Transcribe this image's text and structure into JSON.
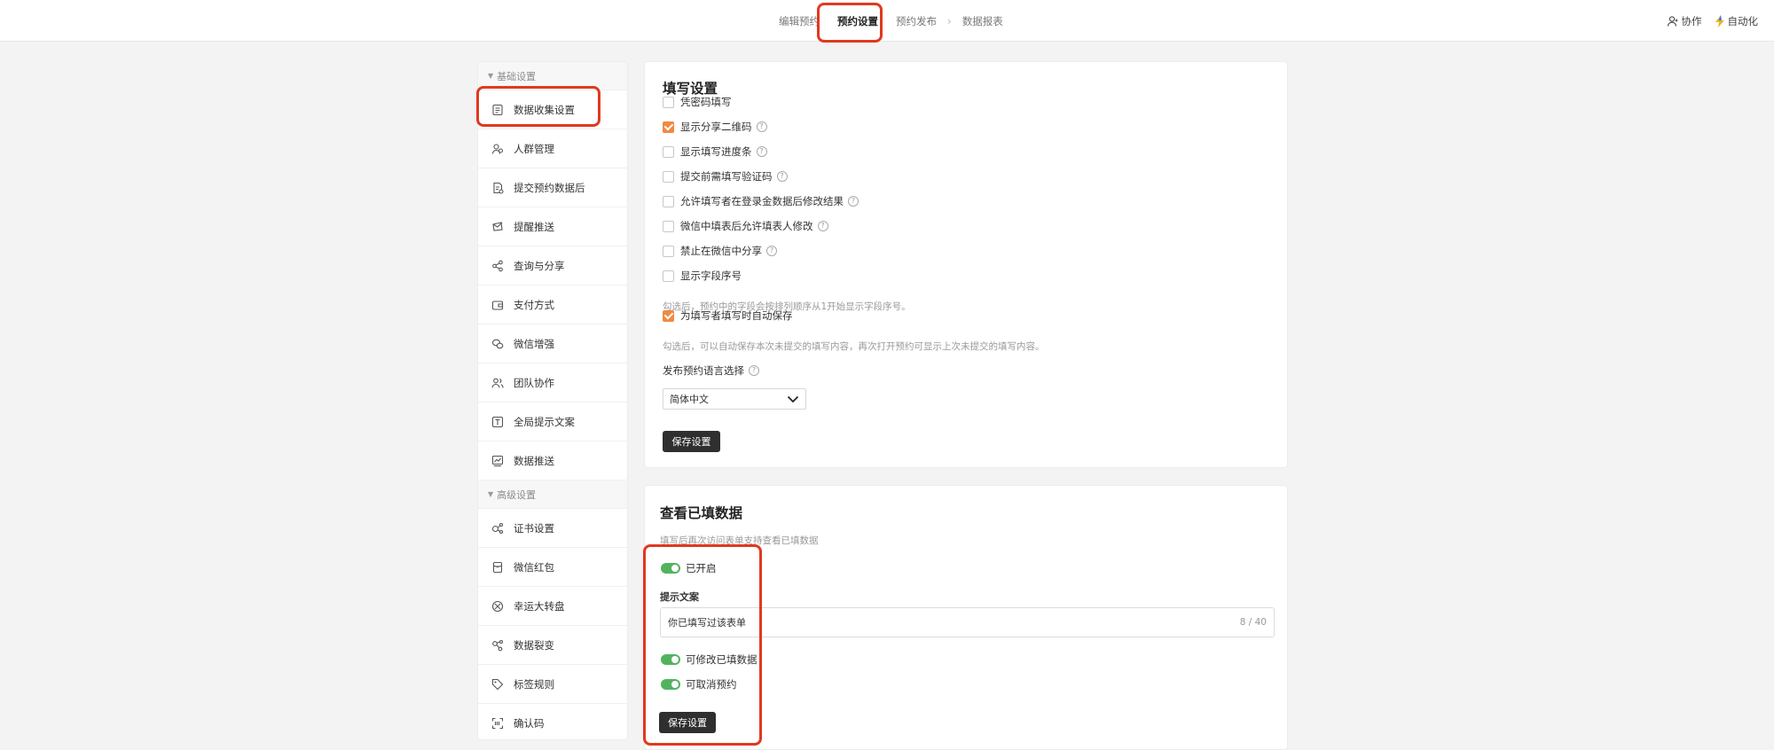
{
  "steps": [
    "编辑预约",
    "预约设置",
    "预约发布",
    "数据报表"
  ],
  "topright": {
    "collab": "协作",
    "automation": "自动化"
  },
  "sidebar": {
    "group1": "基础设置",
    "group2": "高级设置",
    "basic": [
      {
        "label": "数据收集设置",
        "icon": "form-icon"
      },
      {
        "label": "人群管理",
        "icon": "user-group-icon"
      },
      {
        "label": "提交预约数据后",
        "icon": "submit-doc-icon"
      },
      {
        "label": "提醒推送",
        "icon": "reminder-icon"
      },
      {
        "label": "查询与分享",
        "icon": "share-icon"
      },
      {
        "label": "支付方式",
        "icon": "wallet-icon"
      },
      {
        "label": "微信增强",
        "icon": "wechat-icon"
      },
      {
        "label": "团队协作",
        "icon": "team-icon"
      },
      {
        "label": "全局提示文案",
        "icon": "text-icon"
      },
      {
        "label": "数据推送",
        "icon": "data-push-icon"
      }
    ],
    "advanced": [
      {
        "label": "证书设置",
        "icon": "certificate-icon"
      },
      {
        "label": "微信红包",
        "icon": "red-packet-icon"
      },
      {
        "label": "幸运大转盘",
        "icon": "wheel-icon"
      },
      {
        "label": "数据裂变",
        "icon": "fission-icon"
      },
      {
        "label": "标签规则",
        "icon": "tag-icon"
      },
      {
        "label": "确认码",
        "icon": "scan-code-icon"
      }
    ]
  },
  "fill": {
    "title": "填写设置",
    "options": [
      {
        "label": "凭密码填写",
        "checked": false,
        "help": false
      },
      {
        "label": "显示分享二维码",
        "checked": true,
        "help": true
      },
      {
        "label": "显示填写进度条",
        "checked": false,
        "help": true
      },
      {
        "label": "提交前需填写验证码",
        "checked": false,
        "help": true
      },
      {
        "label": "允许填写者在登录金数据后修改结果",
        "checked": false,
        "help": true
      },
      {
        "label": "微信中填表后允许填表人修改",
        "checked": false,
        "help": true
      },
      {
        "label": "禁止在微信中分享",
        "checked": false,
        "help": true
      },
      {
        "label": "显示字段序号",
        "checked": false,
        "help": false
      },
      {
        "label": "为填写者填写时自动保存",
        "checked": true,
        "help": false
      }
    ],
    "hint_serial": "勾选后，预约中的字段会按排列顺序从1开始显示字段序号。",
    "hint_autosave": "勾选后，可以自动保存本次未提交的填写内容，再次打开预约可显示上次未提交的填写内容。",
    "lang_label": "发布预约语言选择",
    "lang_value": "简体中文",
    "save": "保存设置"
  },
  "view": {
    "title": "查看已填数据",
    "desc": "填写后再次访问表单支持查看已填数据",
    "enabled": "已开启",
    "prompt_label": "提示文案",
    "prompt_value": "你已填写过该表单",
    "prompt_count": "8 / 40",
    "modify": "可修改已填数据",
    "cancel": "可取消预约",
    "save": "保存设置"
  },
  "colors": {
    "accent": "#f08a42",
    "toggle": "#52b35e",
    "highlight": "#e0391f",
    "button": "#2f2f2f"
  }
}
